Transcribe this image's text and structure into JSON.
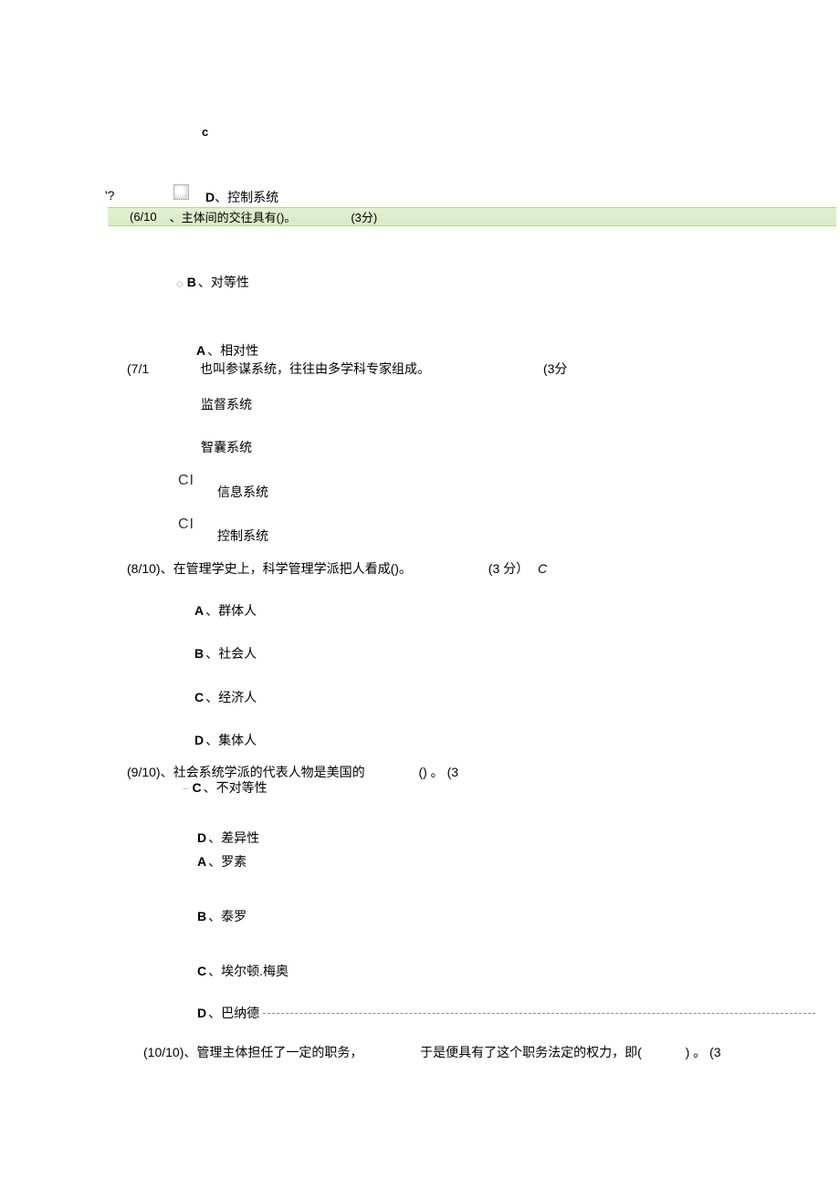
{
  "stray": {
    "c": "c",
    "qmark": "'?"
  },
  "q5_remnant": {
    "opt_d_letter": "D",
    "opt_d_text": "、控制系统"
  },
  "q6": {
    "num": "(6/10",
    "text": "、主体间的交往具有()。",
    "points": "(3分)",
    "opt_b_letter": "B",
    "opt_b_text": "、对等性",
    "opt_a_letter": "A",
    "opt_a_text": "、相对性",
    "opt_c_letter": "C",
    "opt_c_text": "、不对等性",
    "opt_d_letter": "D",
    "opt_d_text": "、差异性"
  },
  "q7": {
    "num": "(7/1",
    "text": "也叫参谋系统，往往由多学科专家组成。",
    "points": "(3分",
    "opt_a": "监督系统",
    "opt_b": "智囊系统",
    "ci": "CI",
    "opt_c": "信息系统",
    "opt_d": "控制系统"
  },
  "q8": {
    "prefix": "(8/10)、在管理学史上，科学管理学派把人看成()。",
    "points": "(3 分）",
    "answer": "C",
    "a_letter": "A",
    "a_text": "、群体人",
    "b_letter": "B",
    "b_text": "、社会人",
    "c_letter": "C",
    "c_text": "、经济人",
    "d_letter": "D",
    "d_text": "、集体人"
  },
  "q9": {
    "prefix": "(9/10)、社会系统学派的代表人物是美国的",
    "paren": "()  。  (3",
    "a_letter": "A",
    "a_text": "、罗素",
    "b_letter": "B",
    "b_text": "、泰罗",
    "c_letter": "C",
    "c_text": "、埃尔顿.梅奥",
    "d_letter": "D",
    "d_text": "、巴纳德"
  },
  "q10": {
    "prefix": "(10/10)、管理主体担任了一定的职务，",
    "mid": "于是便具有了这个职务法定的权力，即(",
    "end": ")  。   (3"
  },
  "dash_marker": "—"
}
